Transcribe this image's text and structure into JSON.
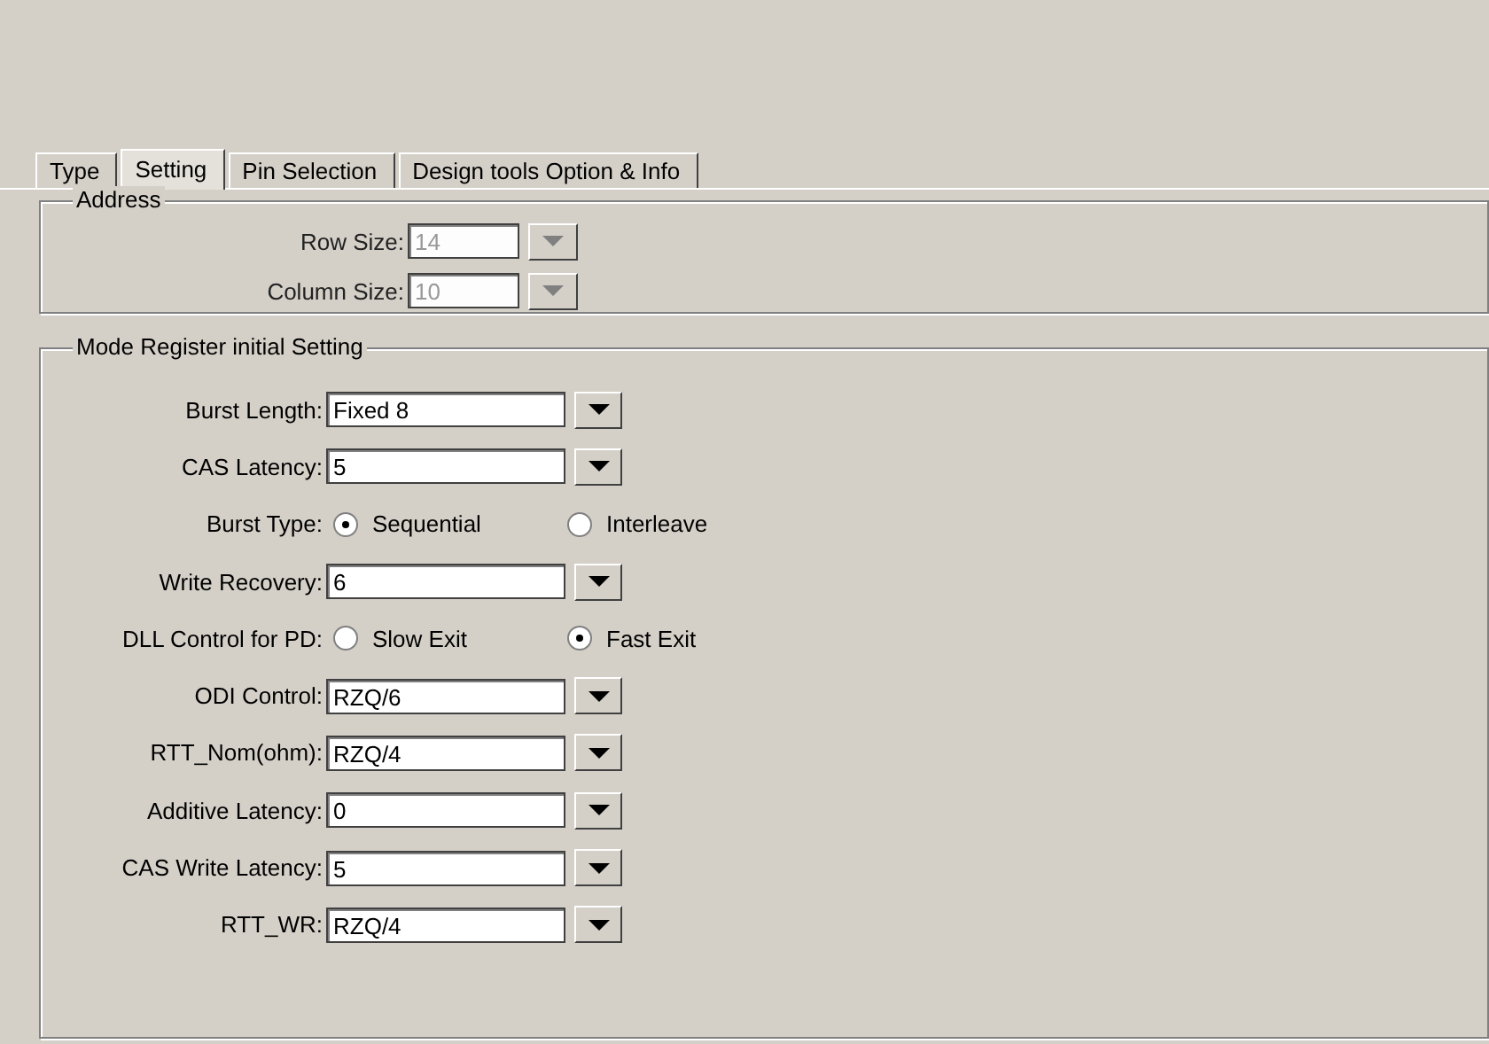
{
  "tabs": [
    {
      "label": "Type",
      "selected": false
    },
    {
      "label": "Setting",
      "selected": true
    },
    {
      "label": "Pin Selection",
      "selected": false
    },
    {
      "label": "Design tools Option & Info",
      "selected": false
    }
  ],
  "address": {
    "title": "Address",
    "rows": [
      {
        "label": "Row Size:",
        "value": "14",
        "disabled": true
      },
      {
        "label": "Column Size:",
        "value": "10",
        "disabled": true
      }
    ]
  },
  "mode_register": {
    "title": "Mode Register initial Setting",
    "rows": [
      {
        "kind": "dropdown",
        "label": "Burst Length:",
        "value": "Fixed 8"
      },
      {
        "kind": "dropdown",
        "label": "CAS Latency:",
        "value": "5"
      },
      {
        "kind": "radio",
        "label": "Burst Type:",
        "options": [
          {
            "label": "Sequential",
            "selected": true
          },
          {
            "label": "Interleave",
            "selected": false
          }
        ]
      },
      {
        "kind": "dropdown",
        "label": "Write Recovery:",
        "value": "6"
      },
      {
        "kind": "radio",
        "label": "DLL Control for PD:",
        "options": [
          {
            "label": "Slow Exit",
            "selected": false
          },
          {
            "label": "Fast Exit",
            "selected": true
          }
        ]
      },
      {
        "kind": "dropdown",
        "label": "ODI Control:",
        "value": "RZQ/6"
      },
      {
        "kind": "dropdown",
        "label": "RTT_Nom(ohm):",
        "value": "RZQ/4"
      },
      {
        "kind": "dropdown",
        "label": "Additive Latency:",
        "value": "0"
      },
      {
        "kind": "dropdown",
        "label": "CAS Write Latency:",
        "value": "5"
      },
      {
        "kind": "dropdown",
        "label": "RTT_WR:",
        "value": "RZQ/4"
      }
    ]
  }
}
